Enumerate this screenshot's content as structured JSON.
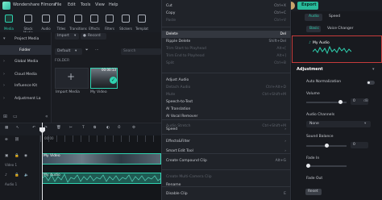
{
  "app": {
    "title": "Wondershare Filmora"
  },
  "menubar": [
    "File",
    "Edit",
    "Tools",
    "View",
    "Help"
  ],
  "header": {
    "export_label": "Export"
  },
  "toolbar": [
    {
      "label": "Media",
      "active": true
    },
    {
      "label": "Stock Media",
      "active": false
    },
    {
      "label": "Audio",
      "active": false
    },
    {
      "label": "Titles",
      "active": false
    },
    {
      "label": "Transitions",
      "active": false
    },
    {
      "label": "Effects",
      "active": false
    },
    {
      "label": "Filters",
      "active": false
    },
    {
      "label": "Stickers",
      "active": false
    },
    {
      "label": "Templat",
      "active": false
    }
  ],
  "sidebar": {
    "items": [
      {
        "label": "Project Media",
        "expanded": true
      },
      {
        "label": "Folder",
        "selected": true
      },
      {
        "label": "Global Media",
        "expanded": false
      },
      {
        "label": "Cloud Media",
        "expanded": false
      },
      {
        "label": "Influence Kit",
        "expanded": false
      },
      {
        "label": "Adjustment La",
        "expanded": false
      }
    ]
  },
  "media": {
    "import_select": "Import",
    "record_select": "Record",
    "default_select": "Default",
    "search_placeholder": "Search",
    "folder_label": "FOLDER",
    "tiles": [
      {
        "label": "Import Media"
      },
      {
        "label": "My Video",
        "duration": "00:00:13"
      }
    ]
  },
  "context_menu": {
    "items": [
      {
        "label": "Cut",
        "shortcut": "Ctrl+X",
        "disabled": false
      },
      {
        "label": "Copy",
        "shortcut": "Ctrl+C",
        "disabled": false
      },
      {
        "label": "Paste",
        "shortcut": "Ctrl+V",
        "disabled": true
      },
      {
        "label": "Delete",
        "shortcut": "Del",
        "disabled": false,
        "highlighted": true
      },
      {
        "label": "Ripple Delete",
        "shortcut": "Shift+Del",
        "disabled": false
      },
      {
        "label": "Trim Start to Playhead",
        "shortcut": "Alt+[",
        "disabled": true
      },
      {
        "label": "Trim End to Playhead",
        "shortcut": "Alt+]",
        "disabled": true
      },
      {
        "label": "Split",
        "shortcut": "Ctrl+B",
        "disabled": true
      },
      {
        "label": "Adjust Audio",
        "shortcut": "",
        "disabled": false
      },
      {
        "label": "Detach Audio",
        "shortcut": "Ctrl+Alt+D",
        "disabled": true
      },
      {
        "label": "Mute",
        "shortcut": "Ctrl+Shift+M",
        "disabled": true
      },
      {
        "label": "Speech-to-Text",
        "shortcut": "",
        "disabled": false
      },
      {
        "label": "AI Translation",
        "shortcut": "",
        "disabled": false
      },
      {
        "label": "AI Vocal Remover",
        "shortcut": "",
        "disabled": false
      },
      {
        "label": "Audio Stretch",
        "shortcut": "Ctrl+Shift+M",
        "disabled": true
      },
      {
        "label": "Speed",
        "shortcut": "",
        "disabled": false,
        "submenu": true
      },
      {
        "label": "Effects&Filter",
        "shortcut": "",
        "disabled": false,
        "submenu": true
      },
      {
        "label": "Smart Edit Tool",
        "shortcut": "",
        "disabled": false,
        "submenu": true
      },
      {
        "label": "Create Compound Clip",
        "shortcut": "Alt+G",
        "disabled": false
      },
      {
        "label": "Create Multi-Camera Clip",
        "shortcut": "",
        "disabled": true
      },
      {
        "label": "Rename",
        "shortcut": "",
        "disabled": false
      },
      {
        "label": "Disable Clip",
        "shortcut": "E",
        "disabled": false
      }
    ]
  },
  "right_panel": {
    "tabs": [
      "Audio",
      "Speed"
    ],
    "subtabs": [
      "Basic",
      "Voice Changer"
    ],
    "track_name": "My Audio",
    "section_adjustment": "Adjustment",
    "auto_normalization": "Auto Normalization",
    "volume_label": "Volume",
    "volume_value": 0,
    "volume_unit": "dB",
    "audio_channels_label": "Audio Channels",
    "audio_channels_value": "None",
    "sound_balance_label": "Sound Balance",
    "sound_balance_value": 0.0,
    "fade_in_label": "Fade In",
    "fade_out_label": "Fade Out",
    "reset_label": "Reset"
  },
  "timeline": {
    "tracks": [
      {
        "label": "Video 1",
        "clip_label": "My Video"
      },
      {
        "label": "Audio 1",
        "clip_label": "My Audio"
      }
    ],
    "ruler_start": "00:00"
  },
  "colors": {
    "accent": "#2fd2b0",
    "export": "#29b99a",
    "highlight_border": "#c63b3b"
  }
}
